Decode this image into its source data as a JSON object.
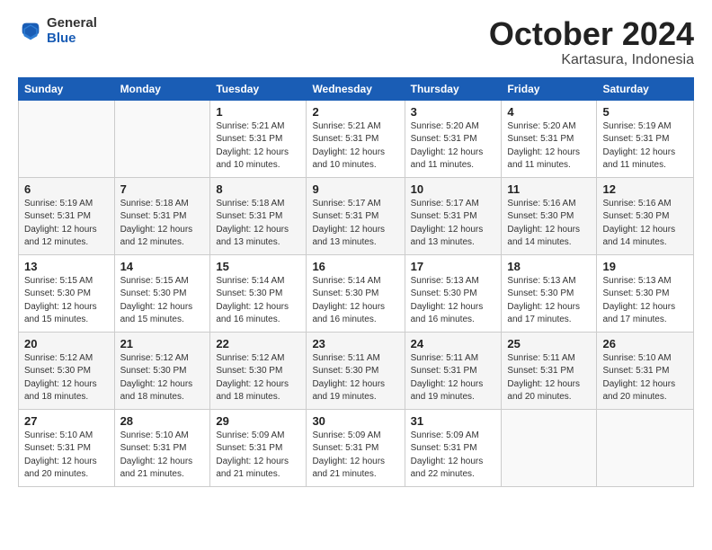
{
  "header": {
    "logo_general": "General",
    "logo_blue": "Blue",
    "month_title": "October 2024",
    "location": "Kartasura, Indonesia"
  },
  "days_of_week": [
    "Sunday",
    "Monday",
    "Tuesday",
    "Wednesday",
    "Thursday",
    "Friday",
    "Saturday"
  ],
  "weeks": [
    [
      {
        "day": "",
        "info": ""
      },
      {
        "day": "",
        "info": ""
      },
      {
        "day": "1",
        "info": "Sunrise: 5:21 AM\nSunset: 5:31 PM\nDaylight: 12 hours\nand 10 minutes."
      },
      {
        "day": "2",
        "info": "Sunrise: 5:21 AM\nSunset: 5:31 PM\nDaylight: 12 hours\nand 10 minutes."
      },
      {
        "day": "3",
        "info": "Sunrise: 5:20 AM\nSunset: 5:31 PM\nDaylight: 12 hours\nand 11 minutes."
      },
      {
        "day": "4",
        "info": "Sunrise: 5:20 AM\nSunset: 5:31 PM\nDaylight: 12 hours\nand 11 minutes."
      },
      {
        "day": "5",
        "info": "Sunrise: 5:19 AM\nSunset: 5:31 PM\nDaylight: 12 hours\nand 11 minutes."
      }
    ],
    [
      {
        "day": "6",
        "info": "Sunrise: 5:19 AM\nSunset: 5:31 PM\nDaylight: 12 hours\nand 12 minutes."
      },
      {
        "day": "7",
        "info": "Sunrise: 5:18 AM\nSunset: 5:31 PM\nDaylight: 12 hours\nand 12 minutes."
      },
      {
        "day": "8",
        "info": "Sunrise: 5:18 AM\nSunset: 5:31 PM\nDaylight: 12 hours\nand 13 minutes."
      },
      {
        "day": "9",
        "info": "Sunrise: 5:17 AM\nSunset: 5:31 PM\nDaylight: 12 hours\nand 13 minutes."
      },
      {
        "day": "10",
        "info": "Sunrise: 5:17 AM\nSunset: 5:31 PM\nDaylight: 12 hours\nand 13 minutes."
      },
      {
        "day": "11",
        "info": "Sunrise: 5:16 AM\nSunset: 5:30 PM\nDaylight: 12 hours\nand 14 minutes."
      },
      {
        "day": "12",
        "info": "Sunrise: 5:16 AM\nSunset: 5:30 PM\nDaylight: 12 hours\nand 14 minutes."
      }
    ],
    [
      {
        "day": "13",
        "info": "Sunrise: 5:15 AM\nSunset: 5:30 PM\nDaylight: 12 hours\nand 15 minutes."
      },
      {
        "day": "14",
        "info": "Sunrise: 5:15 AM\nSunset: 5:30 PM\nDaylight: 12 hours\nand 15 minutes."
      },
      {
        "day": "15",
        "info": "Sunrise: 5:14 AM\nSunset: 5:30 PM\nDaylight: 12 hours\nand 16 minutes."
      },
      {
        "day": "16",
        "info": "Sunrise: 5:14 AM\nSunset: 5:30 PM\nDaylight: 12 hours\nand 16 minutes."
      },
      {
        "day": "17",
        "info": "Sunrise: 5:13 AM\nSunset: 5:30 PM\nDaylight: 12 hours\nand 16 minutes."
      },
      {
        "day": "18",
        "info": "Sunrise: 5:13 AM\nSunset: 5:30 PM\nDaylight: 12 hours\nand 17 minutes."
      },
      {
        "day": "19",
        "info": "Sunrise: 5:13 AM\nSunset: 5:30 PM\nDaylight: 12 hours\nand 17 minutes."
      }
    ],
    [
      {
        "day": "20",
        "info": "Sunrise: 5:12 AM\nSunset: 5:30 PM\nDaylight: 12 hours\nand 18 minutes."
      },
      {
        "day": "21",
        "info": "Sunrise: 5:12 AM\nSunset: 5:30 PM\nDaylight: 12 hours\nand 18 minutes."
      },
      {
        "day": "22",
        "info": "Sunrise: 5:12 AM\nSunset: 5:30 PM\nDaylight: 12 hours\nand 18 minutes."
      },
      {
        "day": "23",
        "info": "Sunrise: 5:11 AM\nSunset: 5:30 PM\nDaylight: 12 hours\nand 19 minutes."
      },
      {
        "day": "24",
        "info": "Sunrise: 5:11 AM\nSunset: 5:31 PM\nDaylight: 12 hours\nand 19 minutes."
      },
      {
        "day": "25",
        "info": "Sunrise: 5:11 AM\nSunset: 5:31 PM\nDaylight: 12 hours\nand 20 minutes."
      },
      {
        "day": "26",
        "info": "Sunrise: 5:10 AM\nSunset: 5:31 PM\nDaylight: 12 hours\nand 20 minutes."
      }
    ],
    [
      {
        "day": "27",
        "info": "Sunrise: 5:10 AM\nSunset: 5:31 PM\nDaylight: 12 hours\nand 20 minutes."
      },
      {
        "day": "28",
        "info": "Sunrise: 5:10 AM\nSunset: 5:31 PM\nDaylight: 12 hours\nand 21 minutes."
      },
      {
        "day": "29",
        "info": "Sunrise: 5:09 AM\nSunset: 5:31 PM\nDaylight: 12 hours\nand 21 minutes."
      },
      {
        "day": "30",
        "info": "Sunrise: 5:09 AM\nSunset: 5:31 PM\nDaylight: 12 hours\nand 21 minutes."
      },
      {
        "day": "31",
        "info": "Sunrise: 5:09 AM\nSunset: 5:31 PM\nDaylight: 12 hours\nand 22 minutes."
      },
      {
        "day": "",
        "info": ""
      },
      {
        "day": "",
        "info": ""
      }
    ]
  ]
}
